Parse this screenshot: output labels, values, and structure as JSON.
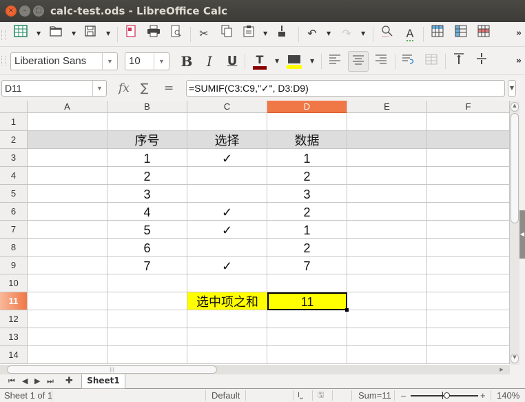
{
  "window": {
    "title": "calc-test.ods - LibreOffice Calc",
    "buttons": {
      "close": "×",
      "minimize": "–",
      "maximize": "□"
    }
  },
  "toolbar_standard": {
    "items": [
      {
        "name": "insert-spreadsheet",
        "glyph": "▦"
      },
      {
        "name": "open",
        "glyph": "📂"
      },
      {
        "name": "save",
        "glyph": "🖫"
      },
      {
        "name": "export-pdf",
        "glyph": "⎙"
      },
      {
        "name": "print",
        "glyph": "🖶"
      },
      {
        "name": "print-preview",
        "glyph": "🔍"
      },
      {
        "name": "cut",
        "glyph": "✂"
      },
      {
        "name": "copy",
        "glyph": "❐"
      },
      {
        "name": "paste",
        "glyph": "📋"
      },
      {
        "name": "clone-formatting",
        "glyph": "🖌"
      },
      {
        "name": "undo",
        "glyph": "↶"
      },
      {
        "name": "redo",
        "glyph": "↷"
      },
      {
        "name": "find-replace",
        "glyph": "⌕"
      },
      {
        "name": "spelling",
        "glyph": "A"
      },
      {
        "name": "insert-row",
        "glyph": "▦"
      },
      {
        "name": "insert-column",
        "glyph": "▦"
      },
      {
        "name": "delete-row",
        "glyph": "▦"
      },
      {
        "name": "more",
        "glyph": "»"
      }
    ]
  },
  "toolbar_formatting": {
    "font_name": "Liberation Sans",
    "font_size": "10",
    "bold": "B",
    "italic": "I",
    "underline": "U",
    "font_color_glyph": "T",
    "font_color": "#8b0000",
    "highlight_color": "#ffff00",
    "align_left": "≡",
    "align_center": "≡",
    "align_right": "≡",
    "wrap_text": "⤶",
    "merge_cells": "▦",
    "align_top": "⊤",
    "center_vertically": "÷",
    "more": "»"
  },
  "formula_bar": {
    "name_box": "D11",
    "function_wizard": "fx",
    "sum": "∑",
    "equals": "=",
    "formula": "=SUMIF(C3:C9,\"✓\", D3:D9)"
  },
  "sheet": {
    "columns": [
      "A",
      "B",
      "C",
      "D",
      "E",
      "F"
    ],
    "selected_column": "D",
    "rows": [
      "1",
      "2",
      "3",
      "4",
      "5",
      "6",
      "7",
      "8",
      "9",
      "10",
      "11",
      "12",
      "13",
      "14"
    ],
    "selected_row": "11",
    "header_row": {
      "B": "序号",
      "C": "选择",
      "D": "数据"
    },
    "data": [
      {
        "row": "3",
        "B": "1",
        "C": "✓",
        "D": "1"
      },
      {
        "row": "4",
        "B": "2",
        "C": "",
        "D": "2"
      },
      {
        "row": "5",
        "B": "3",
        "C": "",
        "D": "3"
      },
      {
        "row": "6",
        "B": "4",
        "C": "✓",
        "D": "2"
      },
      {
        "row": "7",
        "B": "5",
        "C": "✓",
        "D": "1"
      },
      {
        "row": "8",
        "B": "6",
        "C": "",
        "D": "2"
      },
      {
        "row": "9",
        "B": "7",
        "C": "✓",
        "D": "7"
      }
    ],
    "summary": {
      "label": "选中项之和",
      "value": "11"
    },
    "colors": {
      "header_band": "#dddddd",
      "highlight": "#ffff00",
      "selection_accent": "#f07746"
    }
  },
  "tabs": {
    "nav": [
      "⏮",
      "◀",
      "▶",
      "⏭"
    ],
    "add": "✚",
    "sheets": [
      "Sheet1"
    ]
  },
  "statusbar": {
    "sheet_info": "Sheet 1 of 1",
    "page_style": "Default",
    "insert_mode": "I⎵",
    "doc_modified": "🖫",
    "sum": "Sum=11",
    "zoom_minus": "–",
    "zoom_plus": "+",
    "zoom": "140%"
  }
}
